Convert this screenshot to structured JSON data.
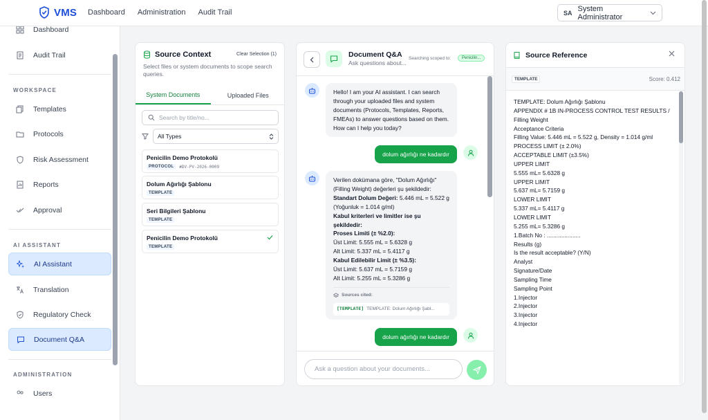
{
  "app": {
    "name": "VMS"
  },
  "nav": {
    "items": [
      "Dashboard",
      "Administration",
      "Audit Trail"
    ]
  },
  "user": {
    "initials": "SA",
    "name": "System Administrator"
  },
  "sidebar": {
    "top_items": [
      {
        "label": "Dashboard",
        "icon": "grid-icon"
      },
      {
        "label": "Audit Trail",
        "icon": "list-icon"
      }
    ],
    "workspace_title": "WORKSPACE",
    "workspace_items": [
      {
        "label": "Templates",
        "icon": "template-icon"
      },
      {
        "label": "Protocols",
        "icon": "folder-icon"
      },
      {
        "label": "Risk Assessment",
        "icon": "shield-icon"
      },
      {
        "label": "Reports",
        "icon": "report-icon"
      },
      {
        "label": "Approval",
        "icon": "check-double-icon"
      }
    ],
    "ai_title": "AI ASSISTANT",
    "ai_items": [
      {
        "label": "AI Assistant",
        "icon": "sparkle-icon"
      },
      {
        "label": "Translation",
        "icon": "translate-icon"
      },
      {
        "label": "Regulatory Check",
        "icon": "shield-check-icon"
      },
      {
        "label": "Document Q&A",
        "icon": "chat-icon"
      }
    ],
    "admin_title": "ADMINISTRATION",
    "admin_items": [
      {
        "label": "Users",
        "icon": "users-icon"
      }
    ]
  },
  "source_context": {
    "title": "Source Context",
    "clear": "Clear Selection (1)",
    "description": "Select files or system documents to scope search queries.",
    "tabs": [
      "System Documents",
      "Uploaded Files"
    ],
    "search_placeholder": "Search by title/no...",
    "filter_value": "All Types",
    "documents": [
      {
        "name": "Penicilin Demo Protokolü",
        "tag": "PROTOCOL",
        "code": "#DV-PV-2026-0009"
      },
      {
        "name": "Dolum Ağırlığı Şablonu",
        "tag": "TEMPLATE",
        "code": ""
      },
      {
        "name": "Seri Bilgileri Şablonu",
        "tag": "TEMPLATE",
        "code": ""
      },
      {
        "name": "Penicilin Demo Protokolü",
        "tag": "TEMPLATE",
        "code": ""
      }
    ]
  },
  "chat": {
    "title": "Document Q&A",
    "subtitle": "Ask questions about...",
    "scope_label": "Searching scoped to:",
    "scope_value": "Penicilin...",
    "greeting": "Hello! I am your AI assistant. I can search through your uploaded files and system documents (Protocols, Templates, Reports, FMEAs) to answer questions based on them. How can I help you today?",
    "user_message_1": "dolum ağırlığı ne kadardır",
    "answer": {
      "intro": "Verilen dokümana göre, \"Dolum Ağırlığı\" (Filling Weight) değerleri şu şekildedir:",
      "std_label": "Standart Dolum Değeri:",
      "std_value": " 5.446 mL = 5.522 g (Yoğunluk = 1.014 g/ml)",
      "criteria_label": "Kabul kriterleri ve limitler ise şu şekildedir:",
      "process_label": "Proses Limiti (± %2.0):",
      "process_upper": "Üst Limit: 5.555 mL = 5.6328 g",
      "process_lower": "Alt Limit: 5.337 mL = 5.4117 g",
      "accept_label": "Kabul Edilebilir Limit (± %3.5):",
      "accept_upper": "Üst Limit: 5.637 mL = 5.7159 g",
      "accept_lower": "Alt Limit: 5.255 mL = 5.3286 g",
      "sources_label": "Sources cited:",
      "source_tag": "[TEMPLATE]",
      "source_text": "TEMPLATE: Dolum Ağırlığı Şabl..."
    },
    "user_message_2": "dolum ağırlığı ne kadardır",
    "input_placeholder": "Ask a question about your documents..."
  },
  "source_reference": {
    "title": "Source Reference",
    "tag": "TEMPLATE",
    "score": "Score: 0.412",
    "lines": [
      "TEMPLATE: Dolum Ağırlığı Şablonu",
      "APPENDIX # 1B IN-PROCESS CONTROL TEST RESULTS /",
      "Filling Weight",
      "Acceptance Criteria",
      "Filling Value: 5.446 mL = 5.522 g, Density = 1.014 g/ml",
      "PROCESS LIMIT (± 2.0%)",
      "ACCEPTABLE LIMIT (±3.5%)",
      "UPPER LIMIT",
      "5.555 mL= 5.6328 g",
      "UPPER LIMIT",
      "5.637 mL= 5.7159 g",
      "LOWER LIMIT",
      "5.337 mL= 5.4117 g",
      "LOWER LIMIT",
      "5.255 mL= 5.3286 g",
      "1.Batch No : .....................",
      "Results (g)",
      "Is the result acceptable? (Y/N)",
      "Analyst",
      "Signature/Date",
      "Sampling Time",
      "Sampling Point",
      "1.Injector",
      "2.Injector",
      "3.Injector",
      "4.Injector"
    ]
  },
  "colors": {
    "brand": "#1d4ed8",
    "accent": "#16a34a",
    "active_bg": "#dbeafe"
  }
}
